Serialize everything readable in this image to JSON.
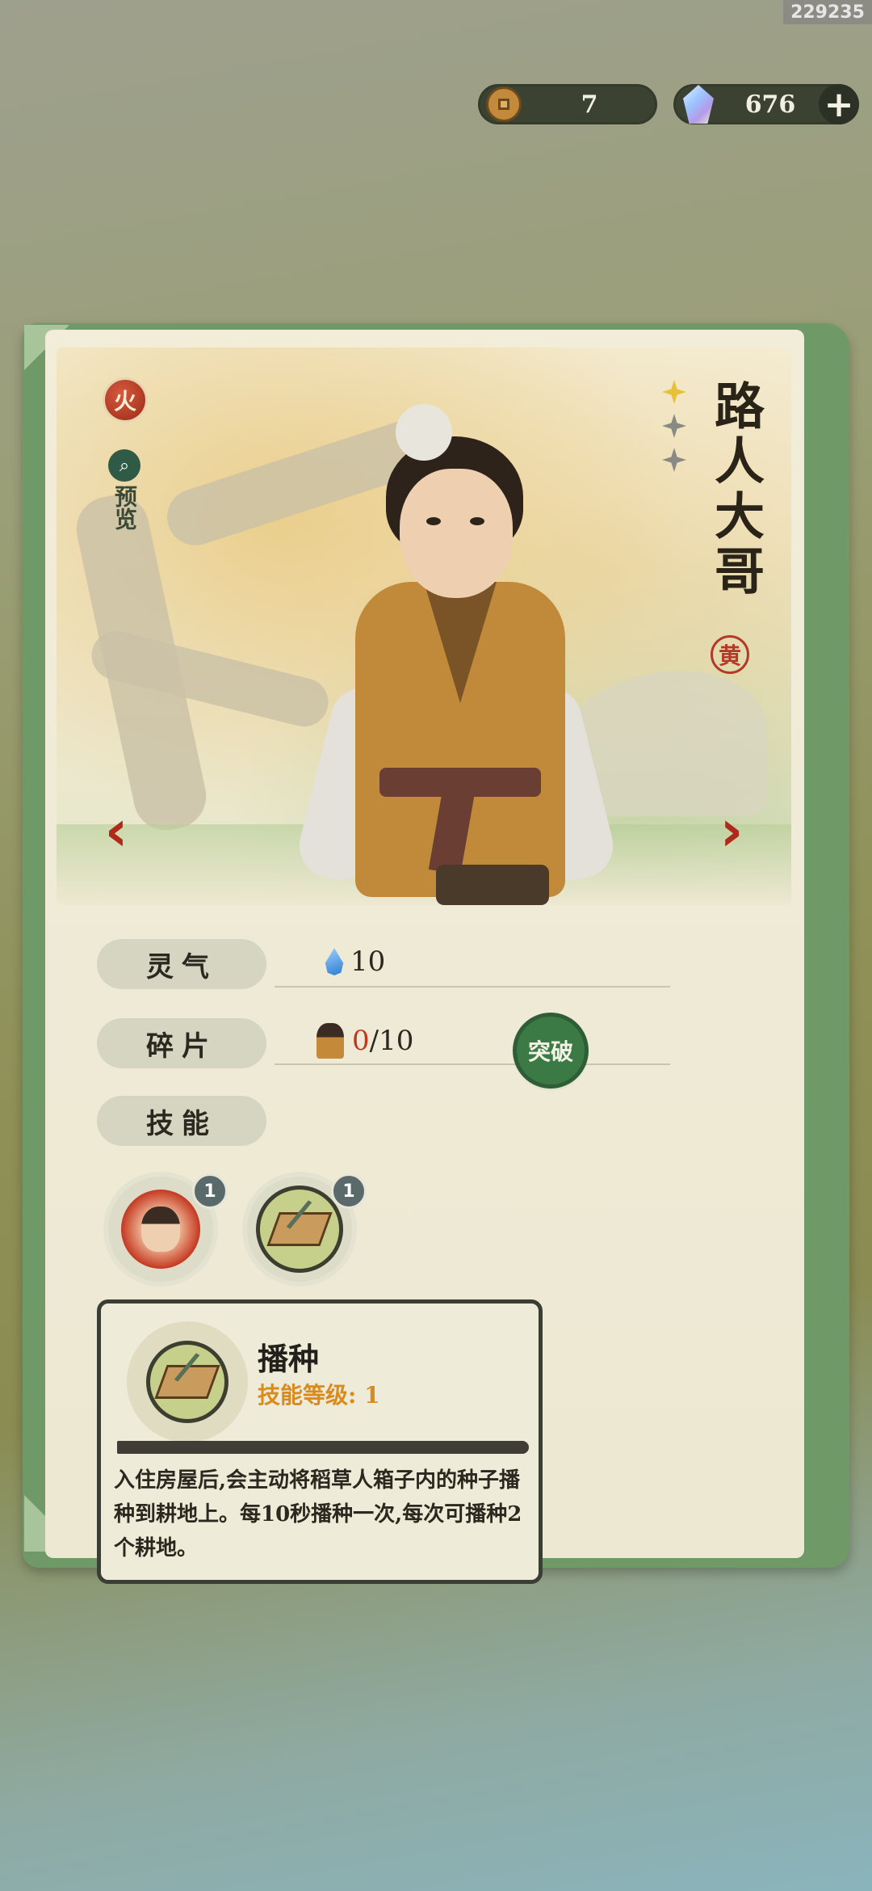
{
  "watermark_id": "229235",
  "currency": {
    "coins": "7",
    "crystals": "676",
    "coin_icon": "copper-coin-icon",
    "crystal_icon": "spirit-crystal-icon"
  },
  "character": {
    "element": "火",
    "preview_label": "预览",
    "name": "路人大哥",
    "rarity": "黄",
    "stars_total": 3,
    "stars_lit": 1
  },
  "stats": {
    "aura_label": "灵气",
    "aura_value": "10",
    "fragments_label": "碎片",
    "fragments_current": "0",
    "fragments_total": "/10",
    "breakthrough_label": "突破",
    "skills_label": "技能"
  },
  "skills": [
    {
      "icon": "character-portrait-skill-icon",
      "level": "1"
    },
    {
      "icon": "hoe-sowing-skill-icon",
      "level": "1"
    }
  ],
  "skill_detail": {
    "name": "播种",
    "level_text": "技能等级: 1",
    "description": "入住房屋后,会主动将稻草人箱子内的种子播种到耕地上。每10秒播种一次,每次可播种2个耕地。"
  },
  "colors": {
    "accent_red": "#b02a1c",
    "accent_green": "#3c7a45",
    "skill_level_orange": "#d98b1e"
  }
}
